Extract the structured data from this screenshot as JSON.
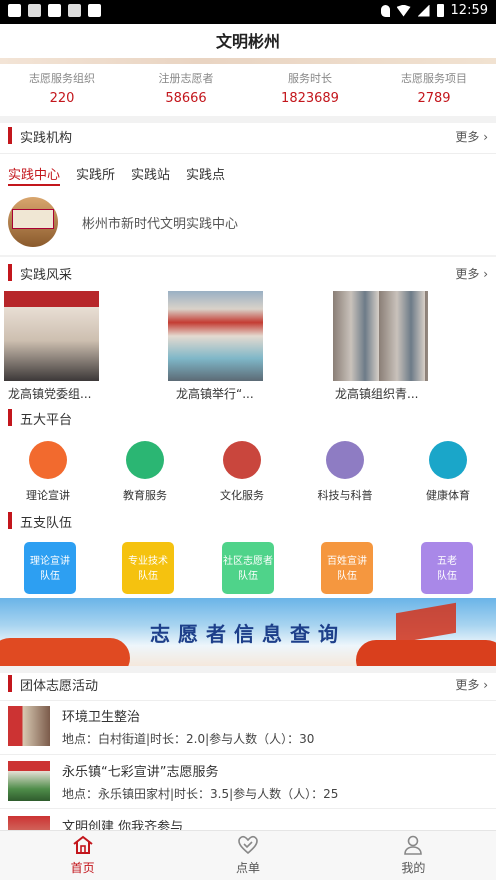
{
  "status_bar": {
    "time": "12:59"
  },
  "header": {
    "title": "文明彬州"
  },
  "stats": [
    {
      "label": "志愿服务组织",
      "value": "220"
    },
    {
      "label": "注册志愿者",
      "value": "58666"
    },
    {
      "label": "服务时长",
      "value": "1823689"
    },
    {
      "label": "志愿服务项目",
      "value": "2789"
    }
  ],
  "practice_org": {
    "title": "实践机构",
    "more": "更多",
    "tabs": [
      "实践中心",
      "实践所",
      "实践站",
      "实践点"
    ],
    "active_tab": "实践中心",
    "item_name": "彬州市新时代文明实践中心"
  },
  "practice_style": {
    "title": "实践风采",
    "more": "更多",
    "items": [
      {
        "caption": "龙高镇党委组..."
      },
      {
        "caption": "龙高镇举行“..."
      },
      {
        "caption": "龙高镇组织青..."
      }
    ]
  },
  "platforms": {
    "title": "五大平台",
    "items": [
      {
        "label": "理论宣讲",
        "icon": "lecture-icon",
        "color": "#f26a2e"
      },
      {
        "label": "教育服务",
        "icon": "book-icon",
        "color": "#2bb673"
      },
      {
        "label": "文化服务",
        "icon": "fan-icon",
        "color": "#c9463d"
      },
      {
        "label": "科技与科普",
        "icon": "science-icon",
        "color": "#8e7cc3"
      },
      {
        "label": "健康体育",
        "icon": "runner-icon",
        "color": "#1aa6c9"
      }
    ]
  },
  "teams": {
    "title": "五支队伍",
    "items": [
      {
        "line1": "理论宣讲",
        "line2": "队伍",
        "color": "#2d9ff2"
      },
      {
        "line1": "专业技术",
        "line2": "队伍",
        "color": "#f5c20f"
      },
      {
        "line1": "社区志愿者",
        "line2": "队伍",
        "color": "#4fd38a"
      },
      {
        "line1": "百姓宣讲",
        "line2": "队伍",
        "color": "#f5973f"
      },
      {
        "line1": "五老",
        "line2": "队伍",
        "color": "#a988e8"
      }
    ]
  },
  "banner": {
    "text": "志愿者信息查询"
  },
  "activities": {
    "title": "团体志愿活动",
    "more": "更多",
    "items": [
      {
        "title": "环境卫生整治",
        "meta": "地点：白村街道|时长：2.0|参与人数（人）：30"
      },
      {
        "title": "永乐镇“七彩宣讲”志愿服务",
        "meta": "地点：永乐镇田家村|时长：3.5|参与人数（人）：25"
      },
      {
        "title": "文明创建 你我齐参与",
        "meta": ""
      }
    ]
  },
  "bottom_nav": {
    "items": [
      {
        "label": "首页",
        "icon": "home-icon",
        "active": true
      },
      {
        "label": "点单",
        "icon": "order-icon",
        "active": false
      },
      {
        "label": "我的",
        "icon": "user-icon",
        "active": false
      }
    ]
  }
}
